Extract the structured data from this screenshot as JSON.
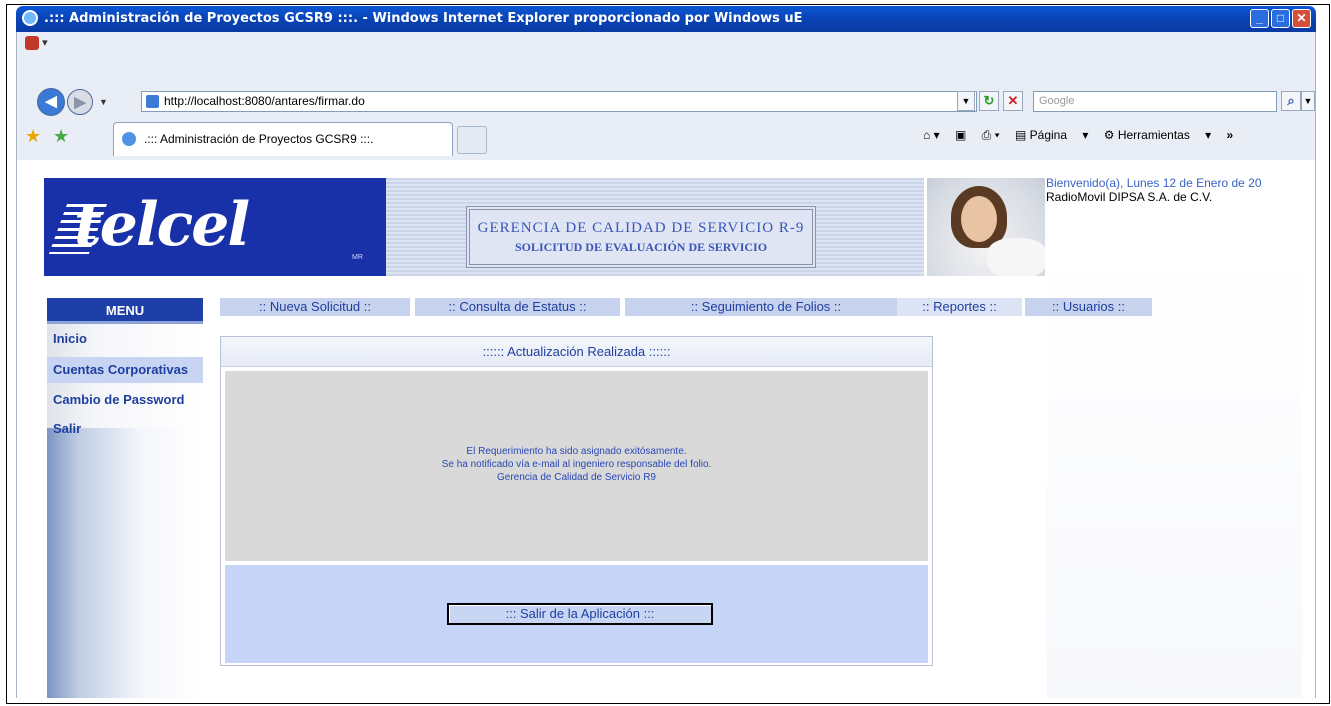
{
  "window": {
    "title": ".::: Administración de Proyectos GCSR9 :::. - Windows Internet Explorer proporcionado por Windows uE"
  },
  "browser": {
    "address": "http://localhost:8080/antares/firmar.do",
    "search_placeholder": "Google",
    "tab_title": ".::: Administración de Proyectos GCSR9 :::.",
    "tools": {
      "page_label": "Página",
      "tools_label": "Herramientas",
      "more": "»"
    }
  },
  "header": {
    "logo_text": "telcel",
    "logo_mark": "MR",
    "title_line1": "GERENCIA DE CALIDAD DE SERVICIO R-9",
    "title_line2": "SOLICITUD DE EVALUACIÓN DE SERVICIO",
    "welcome": "Bienvenido(a), Lunes 12 de Enero de 20",
    "company": "RadioMovil DIPSA S.A. de C.V."
  },
  "menu": {
    "heading": "MENU",
    "items": [
      {
        "label": "Inicio"
      },
      {
        "label": "Cuentas Corporativas"
      },
      {
        "label": "Cambio de Password"
      },
      {
        "label": "Salir"
      }
    ]
  },
  "topnav": [
    {
      "label": ":: Nueva Solicitud ::"
    },
    {
      "label": ":: Consulta de Estatus ::"
    },
    {
      "label": ":: Seguimiento de Folios ::"
    },
    {
      "label": ":: Reportes ::"
    },
    {
      "label": ":: Usuarios ::"
    }
  ],
  "panel": {
    "heading": ":::::: Actualización Realizada ::::::",
    "message": [
      "El Requerimiento ha sido asignado exitósamente.",
      "Se ha notificado vía e-mail al ingeniero responsable del folio.",
      "Gerencia de Calidad de Servicio R9"
    ],
    "exit_label": "::: Salir de la Aplicación :::"
  },
  "colors": {
    "brand_blue": "#1830a8",
    "link_blue": "#1f3f9f",
    "nav_bg": "#c6d2ee",
    "titlebar": "#0a57d6"
  }
}
